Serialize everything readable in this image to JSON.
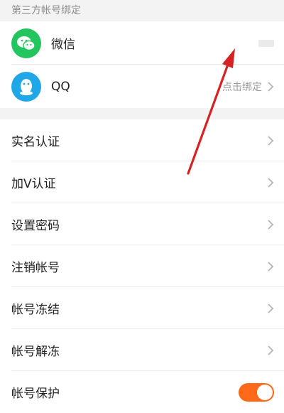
{
  "third_party": {
    "section_title": "第三方帐号绑定",
    "items": [
      {
        "label": "微信",
        "icon": "wechat-icon",
        "color": "#22c55e"
      },
      {
        "label": "QQ",
        "icon": "qq-icon",
        "color": "#1fa7e8",
        "status": "点击绑定"
      }
    ]
  },
  "menu": {
    "items": [
      {
        "label": "实名认证"
      },
      {
        "label": "加V认证"
      },
      {
        "label": "设置密码"
      },
      {
        "label": "注销帐号"
      },
      {
        "label": "帐号冻结"
      },
      {
        "label": "帐号解冻"
      },
      {
        "label": "帐号保护"
      }
    ],
    "protect_enabled": true
  },
  "colors": {
    "accent": "#ff6a1a",
    "annotation_arrow": "#d62222"
  }
}
